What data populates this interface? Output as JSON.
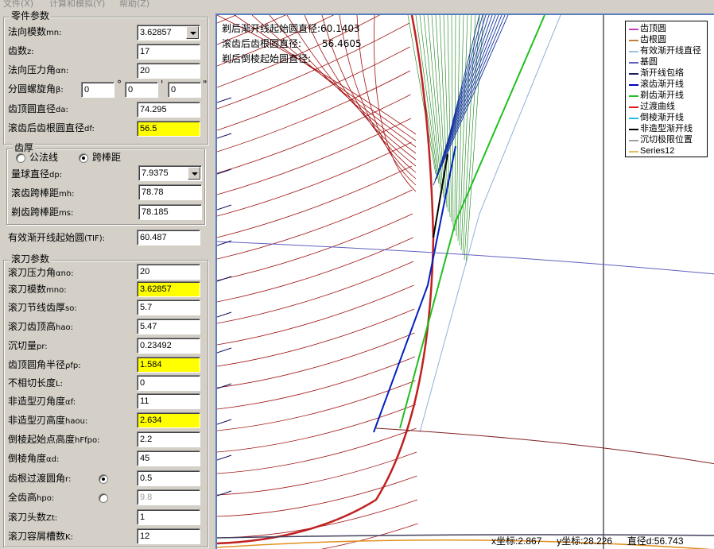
{
  "menu": [
    "文件(X)",
    "计算和模拟(Y)",
    "帮助(Z)"
  ],
  "gear": {
    "title": "零件参数",
    "mn": {
      "label": "法向模数",
      "sub": "mn:",
      "value": "3.62857"
    },
    "z": {
      "label": "齿数",
      "sub": "z:",
      "value": "17"
    },
    "an": {
      "label": "法向压力角",
      "sub": "αn:",
      "value": "20"
    },
    "beta": {
      "label": "分圆螺旋角",
      "sub": "β:",
      "deg": "0",
      "min": "0",
      "sec": "0",
      "deg_mark": "°",
      "min_mark": "'",
      "sec_mark": "\""
    },
    "da": {
      "label": "齿顶圆直径",
      "sub": "da:",
      "value": "74.295"
    },
    "df": {
      "label": "滚齿后齿根圆直径",
      "sub": "df:",
      "value": "56.5"
    }
  },
  "thickness": {
    "title": "齿厚",
    "opt1": "公法线",
    "opt2": "跨棒距",
    "dp": {
      "label": "量球直径",
      "sub": "dp:",
      "value": "7.9375"
    },
    "mh": {
      "label": "滚齿跨棒距",
      "sub": "mh:",
      "value": "78.78"
    },
    "ms": {
      "label": "剃齿跨棒距",
      "sub": "ms:",
      "value": "78.185"
    }
  },
  "tif": {
    "label": "有效渐开线起始圆",
    "sub": "(TIF):",
    "value": "60.487"
  },
  "hob": {
    "title": "滚刀参数",
    "ano": {
      "label": "滚刀压力角",
      "sub": "αno:",
      "value": "20"
    },
    "mno": {
      "label": "滚刀模数",
      "sub": "mno:",
      "value": "3.62857"
    },
    "so": {
      "label": "滚刀节线齿厚",
      "sub": "so:",
      "value": "5.7"
    },
    "hao": {
      "label": "滚刀齿顶高",
      "sub": "hao:",
      "value": "5.47"
    },
    "pr": {
      "label": "沉切量",
      "sub": "pr:",
      "value": "0.23492"
    },
    "pfp": {
      "label": "齿顶圆角半径",
      "sub": "ρfp:",
      "value": "1.584"
    },
    "L": {
      "label": "不相切长度",
      "sub": "L:",
      "value": "0"
    },
    "af": {
      "label": "非造型刃角度",
      "sub": "αf:",
      "value": "11"
    },
    "haou": {
      "label": "非造型刃高度",
      "sub": "haou:",
      "value": "2.634"
    },
    "hffpo": {
      "label": "倒棱起始点高度",
      "sub": "hFfpo:",
      "value": "2.2"
    },
    "ad": {
      "label": "倒棱角度",
      "sub": "αd:",
      "value": "45"
    },
    "r": {
      "label": "齿根过渡圆角",
      "sub": "r:",
      "value": "0.5"
    },
    "hpo": {
      "label": "全齿高",
      "sub": "hpo:",
      "value": "9.8"
    },
    "zt": {
      "label": "滚刀头数",
      "sub": "Zt:",
      "value": "1"
    },
    "K": {
      "label": "滚刀容屑槽数",
      "sub": "K:",
      "value": "12"
    }
  },
  "plot": {
    "info1_label": "剃后渐开线起始圆直径:",
    "info1_value": "60.1403",
    "info2_label": "滚齿后齿根圆直径:",
    "info2_value": "56.4605",
    "info3_label": "剃后倒棱起始圆直径:",
    "info3_value": "",
    "legend": [
      {
        "name": "齿顶圆",
        "color": "#c040c0"
      },
      {
        "name": "齿根圆",
        "color": "#c08040"
      },
      {
        "name": "有效渐开线直径",
        "color": "#a0c0e0"
      },
      {
        "name": "基圆",
        "color": "#6060c0"
      },
      {
        "name": "渐开线包络",
        "color": "#202060"
      },
      {
        "name": "滚齿渐开线",
        "color": "#0000c0"
      },
      {
        "name": "剃齿渐开线",
        "color": "#20c020"
      },
      {
        "name": "过渡曲线",
        "color": "#e02020"
      },
      {
        "name": "倒棱渐开线",
        "color": "#20c0e0"
      },
      {
        "name": "非造型渐开线",
        "color": "#000000"
      },
      {
        "name": "沉切极限位置",
        "color": "#a0a0a0"
      },
      {
        "name": "Series12",
        "color": "#e0c060"
      }
    ],
    "status_x": "x坐标:2.867",
    "status_y": "y坐标:28.226",
    "status_d": "直径d:56.743"
  }
}
